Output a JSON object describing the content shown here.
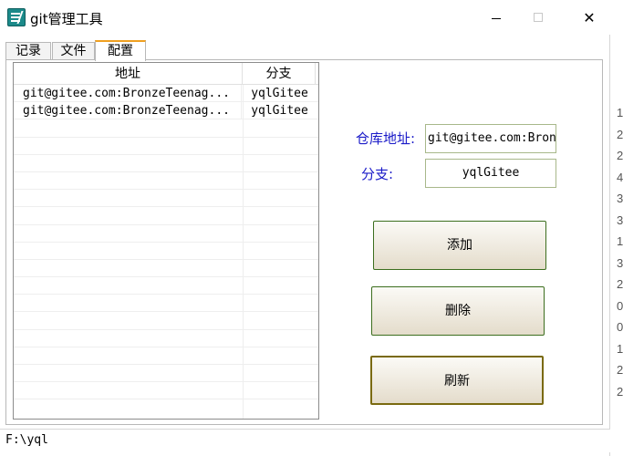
{
  "window": {
    "title": "git管理工具"
  },
  "tabs": [
    {
      "label": "记录"
    },
    {
      "label": "文件"
    },
    {
      "label": "配置"
    }
  ],
  "table": {
    "columns": [
      "地址",
      "分支"
    ],
    "rows": [
      {
        "address": "git@gitee.com:BronzeTeenag...",
        "branch": "yqlGitee"
      },
      {
        "address": "git@gitee.com:BronzeTeenag...",
        "branch": "yqlGitee"
      }
    ]
  },
  "form": {
    "repo_label": "仓库地址:",
    "repo_value": "git@gitee.com:Bron",
    "branch_label": "分支:",
    "branch_value": "yqlGitee"
  },
  "buttons": {
    "add": "添加",
    "delete": "删除",
    "refresh": "刷新"
  },
  "status": {
    "path": "F:\\yql"
  },
  "background_digits": [
    "1",
    "2",
    "2",
    "4",
    "3",
    "3",
    "1",
    "3",
    "2",
    "0",
    "0",
    "1",
    "2",
    "2"
  ]
}
